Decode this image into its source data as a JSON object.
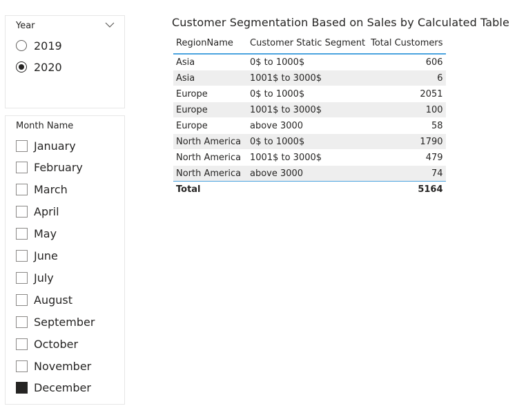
{
  "year_slicer": {
    "title": "Year",
    "options": [
      {
        "label": "2019",
        "selected": false
      },
      {
        "label": "2020",
        "selected": true
      }
    ]
  },
  "month_slicer": {
    "title": "Month Name",
    "options": [
      {
        "label": "January",
        "checked": false
      },
      {
        "label": "February",
        "checked": false
      },
      {
        "label": "March",
        "checked": false
      },
      {
        "label": "April",
        "checked": false
      },
      {
        "label": "May",
        "checked": false
      },
      {
        "label": "June",
        "checked": false
      },
      {
        "label": "July",
        "checked": false
      },
      {
        "label": "August",
        "checked": false
      },
      {
        "label": "September",
        "checked": false
      },
      {
        "label": "October",
        "checked": false
      },
      {
        "label": "November",
        "checked": false
      },
      {
        "label": "December",
        "checked": true
      }
    ]
  },
  "table_visual": {
    "title": "Customer Segmentation Based on Sales by Calculated Table",
    "columns": [
      "RegionName",
      "Customer Static Segment",
      "Total Customers"
    ],
    "rows": [
      [
        "Asia",
        "0$ to 1000$",
        "606"
      ],
      [
        "Asia",
        "1001$ to 3000$",
        "6"
      ],
      [
        "Europe",
        "0$ to 1000$",
        "2051"
      ],
      [
        "Europe",
        "1001$ to 3000$",
        "100"
      ],
      [
        "Europe",
        "above 3000",
        "58"
      ],
      [
        "North America",
        "0$ to 1000$",
        "1790"
      ],
      [
        "North America",
        "1001$ to 3000$",
        "479"
      ],
      [
        "North America",
        "above 3000",
        "74"
      ]
    ],
    "total": {
      "label": "Total",
      "value": "5164"
    }
  },
  "colors": {
    "accent_line": "#4aa3df",
    "row_alt": "#eeeeee",
    "text": "#252423"
  }
}
